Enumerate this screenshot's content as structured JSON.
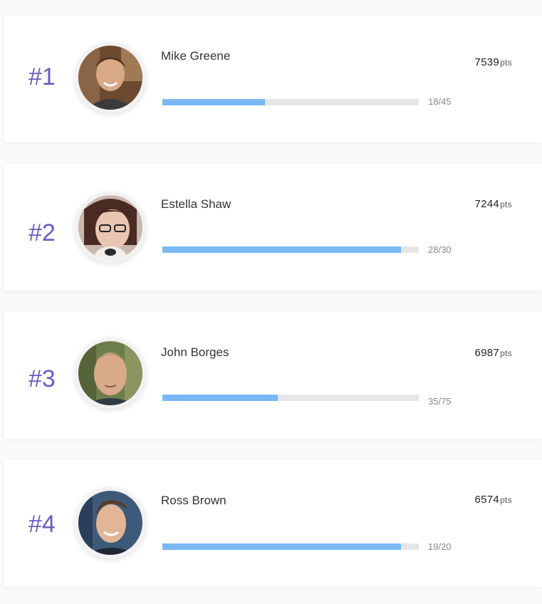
{
  "colors": {
    "rank": "#6a5cc4",
    "bar_fill": "#7ab8f5",
    "bar_track": "#e6e6e6"
  },
  "leaderboard": [
    {
      "rank": "#1",
      "name": "Mike Greene",
      "points": "7539",
      "unit": "pts",
      "progress_label": "18/45",
      "progress": 0.4,
      "avatar_icon": "user-avatar"
    },
    {
      "rank": "#2",
      "name": "Estella Shaw",
      "points": "7244",
      "unit": "pts",
      "progress_label": "28/30",
      "progress": 0.93,
      "avatar_icon": "user-avatar"
    },
    {
      "rank": "#3",
      "name": "John Borges",
      "points": "6987",
      "unit": "pts",
      "progress_label": "35/75",
      "progress": 0.45,
      "avatar_icon": "user-avatar"
    },
    {
      "rank": "#4",
      "name": "Ross Brown",
      "points": "6574",
      "unit": "pts",
      "progress_label": "19/20",
      "progress": 0.93,
      "avatar_icon": "user-avatar"
    }
  ]
}
